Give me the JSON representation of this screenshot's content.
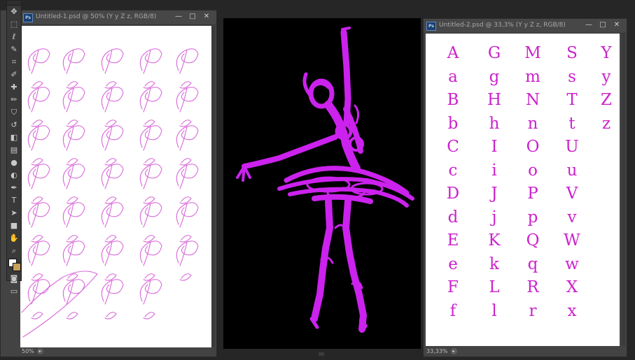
{
  "left_window": {
    "title": "Untitled-1.psd @ 50% (Y y Z z, RGB/8)",
    "badge": "Ps",
    "zoom": "50%",
    "controls": [
      "—",
      "□",
      "✕"
    ]
  },
  "right_window": {
    "title": "Untitled-2.psd @ 33,3% (Y y Z z, RGB/8)",
    "badge": "Ps",
    "zoom": "33,33%",
    "controls": [
      "—",
      "□",
      "✕"
    ],
    "columns": [
      [
        "A",
        "a",
        "B",
        "b",
        "C",
        "c",
        "D",
        "d",
        "E",
        "e",
        "F",
        "f"
      ],
      [
        "G",
        "g",
        "H",
        "h",
        "I",
        "i",
        "J",
        "j",
        "K",
        "k",
        "L",
        "l"
      ],
      [
        "M",
        "m",
        "N",
        "n",
        "O",
        "o",
        "P",
        "p",
        "Q",
        "q",
        "R",
        "r"
      ],
      [
        "S",
        "s",
        "T",
        "t",
        "U",
        "u",
        "V",
        "v",
        "W",
        "w",
        "X",
        "x"
      ],
      [
        "Y",
        "y",
        "Z",
        "z"
      ]
    ]
  },
  "tools": [
    {
      "name": "move-tool",
      "glyph": "✥"
    },
    {
      "name": "marquee-tool",
      "glyph": "⬚"
    },
    {
      "name": "lasso-tool",
      "glyph": "ℓ"
    },
    {
      "name": "quick-select-tool",
      "glyph": "✎"
    },
    {
      "name": "crop-tool",
      "glyph": "⌗"
    },
    {
      "name": "eyedropper-tool",
      "glyph": "✐"
    },
    {
      "name": "healing-brush-tool",
      "glyph": "✚"
    },
    {
      "name": "brush-tool",
      "glyph": "✏"
    },
    {
      "name": "clone-stamp-tool",
      "glyph": "⛉"
    },
    {
      "name": "history-brush-tool",
      "glyph": "↺"
    },
    {
      "name": "eraser-tool",
      "glyph": "◧"
    },
    {
      "name": "gradient-tool",
      "glyph": "▤"
    },
    {
      "name": "blur-tool",
      "glyph": "●"
    },
    {
      "name": "dodge-tool",
      "glyph": "◐"
    },
    {
      "name": "pen-tool",
      "glyph": "✒"
    },
    {
      "name": "type-tool",
      "glyph": "T"
    },
    {
      "name": "path-select-tool",
      "glyph": "➤"
    },
    {
      "name": "rectangle-tool",
      "glyph": "■"
    },
    {
      "name": "hand-tool",
      "glyph": "✋"
    },
    {
      "name": "zoom-tool",
      "glyph": "⌕"
    }
  ],
  "bottom_tools": [
    {
      "name": "quick-mask-icon",
      "glyph": "◙"
    },
    {
      "name": "screen-mode-icon",
      "glyph": "▭"
    }
  ],
  "colors": {
    "letter_magenta": "#cc22cc",
    "dancer_magenta": "#cc22ee",
    "script_magenta": "#d24fd2",
    "foreground": "#ffffff",
    "background": "#c8a25a"
  }
}
